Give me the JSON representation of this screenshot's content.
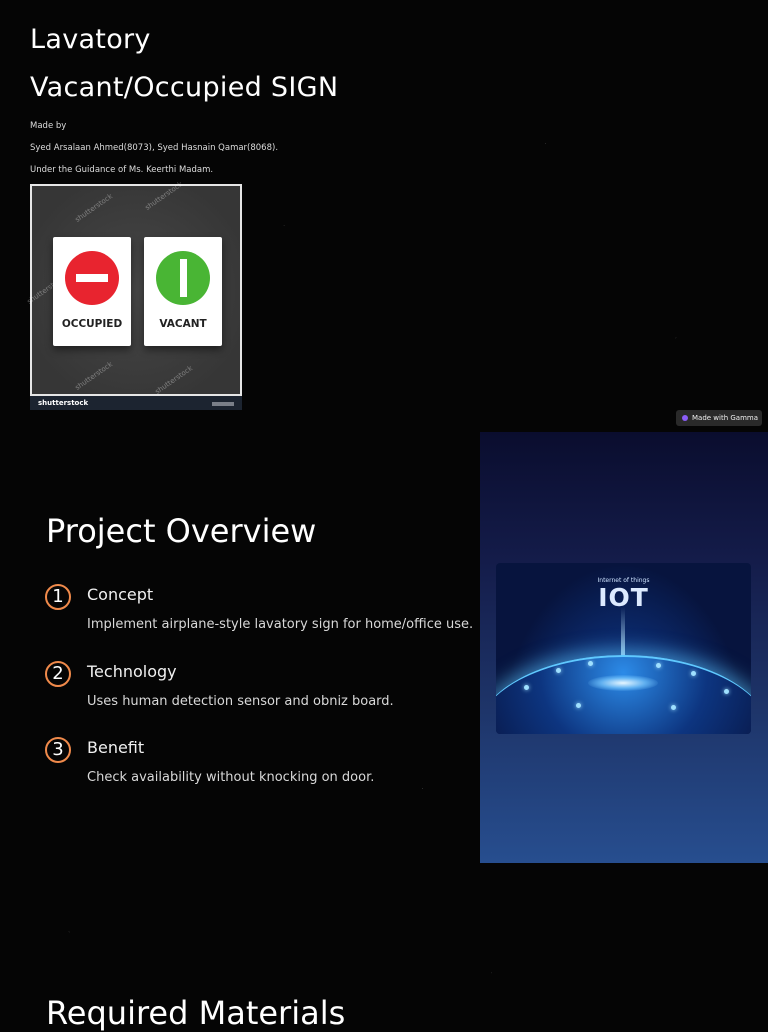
{
  "header": {
    "title_line1": "Lavatory",
    "title_line2": "Vacant/Occupied SIGN",
    "made_by": "Made by",
    "authors": "Syed Arsalaan Ahmed(8073), Syed Hasnain Qamar(8068).",
    "guidance": "Under the Guidance of Ms. Keerthi Madam."
  },
  "sign_image": {
    "occupied_label": "OCCUPIED",
    "vacant_label": "VACANT",
    "watermark": "shutterstock",
    "footer_brand": "shutterstock",
    "occupied_color": "#e8242f",
    "vacant_color": "#49b534"
  },
  "badge": {
    "label": "Made with Gamma"
  },
  "overview": {
    "title": "Project Overview",
    "items": [
      {
        "number": "1",
        "title": "Concept",
        "desc": "Implement airplane-style lavatory sign for home/office use."
      },
      {
        "number": "2",
        "title": "Technology",
        "desc": "Uses human detection sensor and obniz board."
      },
      {
        "number": "3",
        "title": "Benefit",
        "desc": "Check availability without knocking on door."
      }
    ],
    "accent": "#f08a4b"
  },
  "iot_image": {
    "subtitle": "Internet of things",
    "title": "IOT"
  },
  "materials": {
    "title": "Required Materials"
  }
}
